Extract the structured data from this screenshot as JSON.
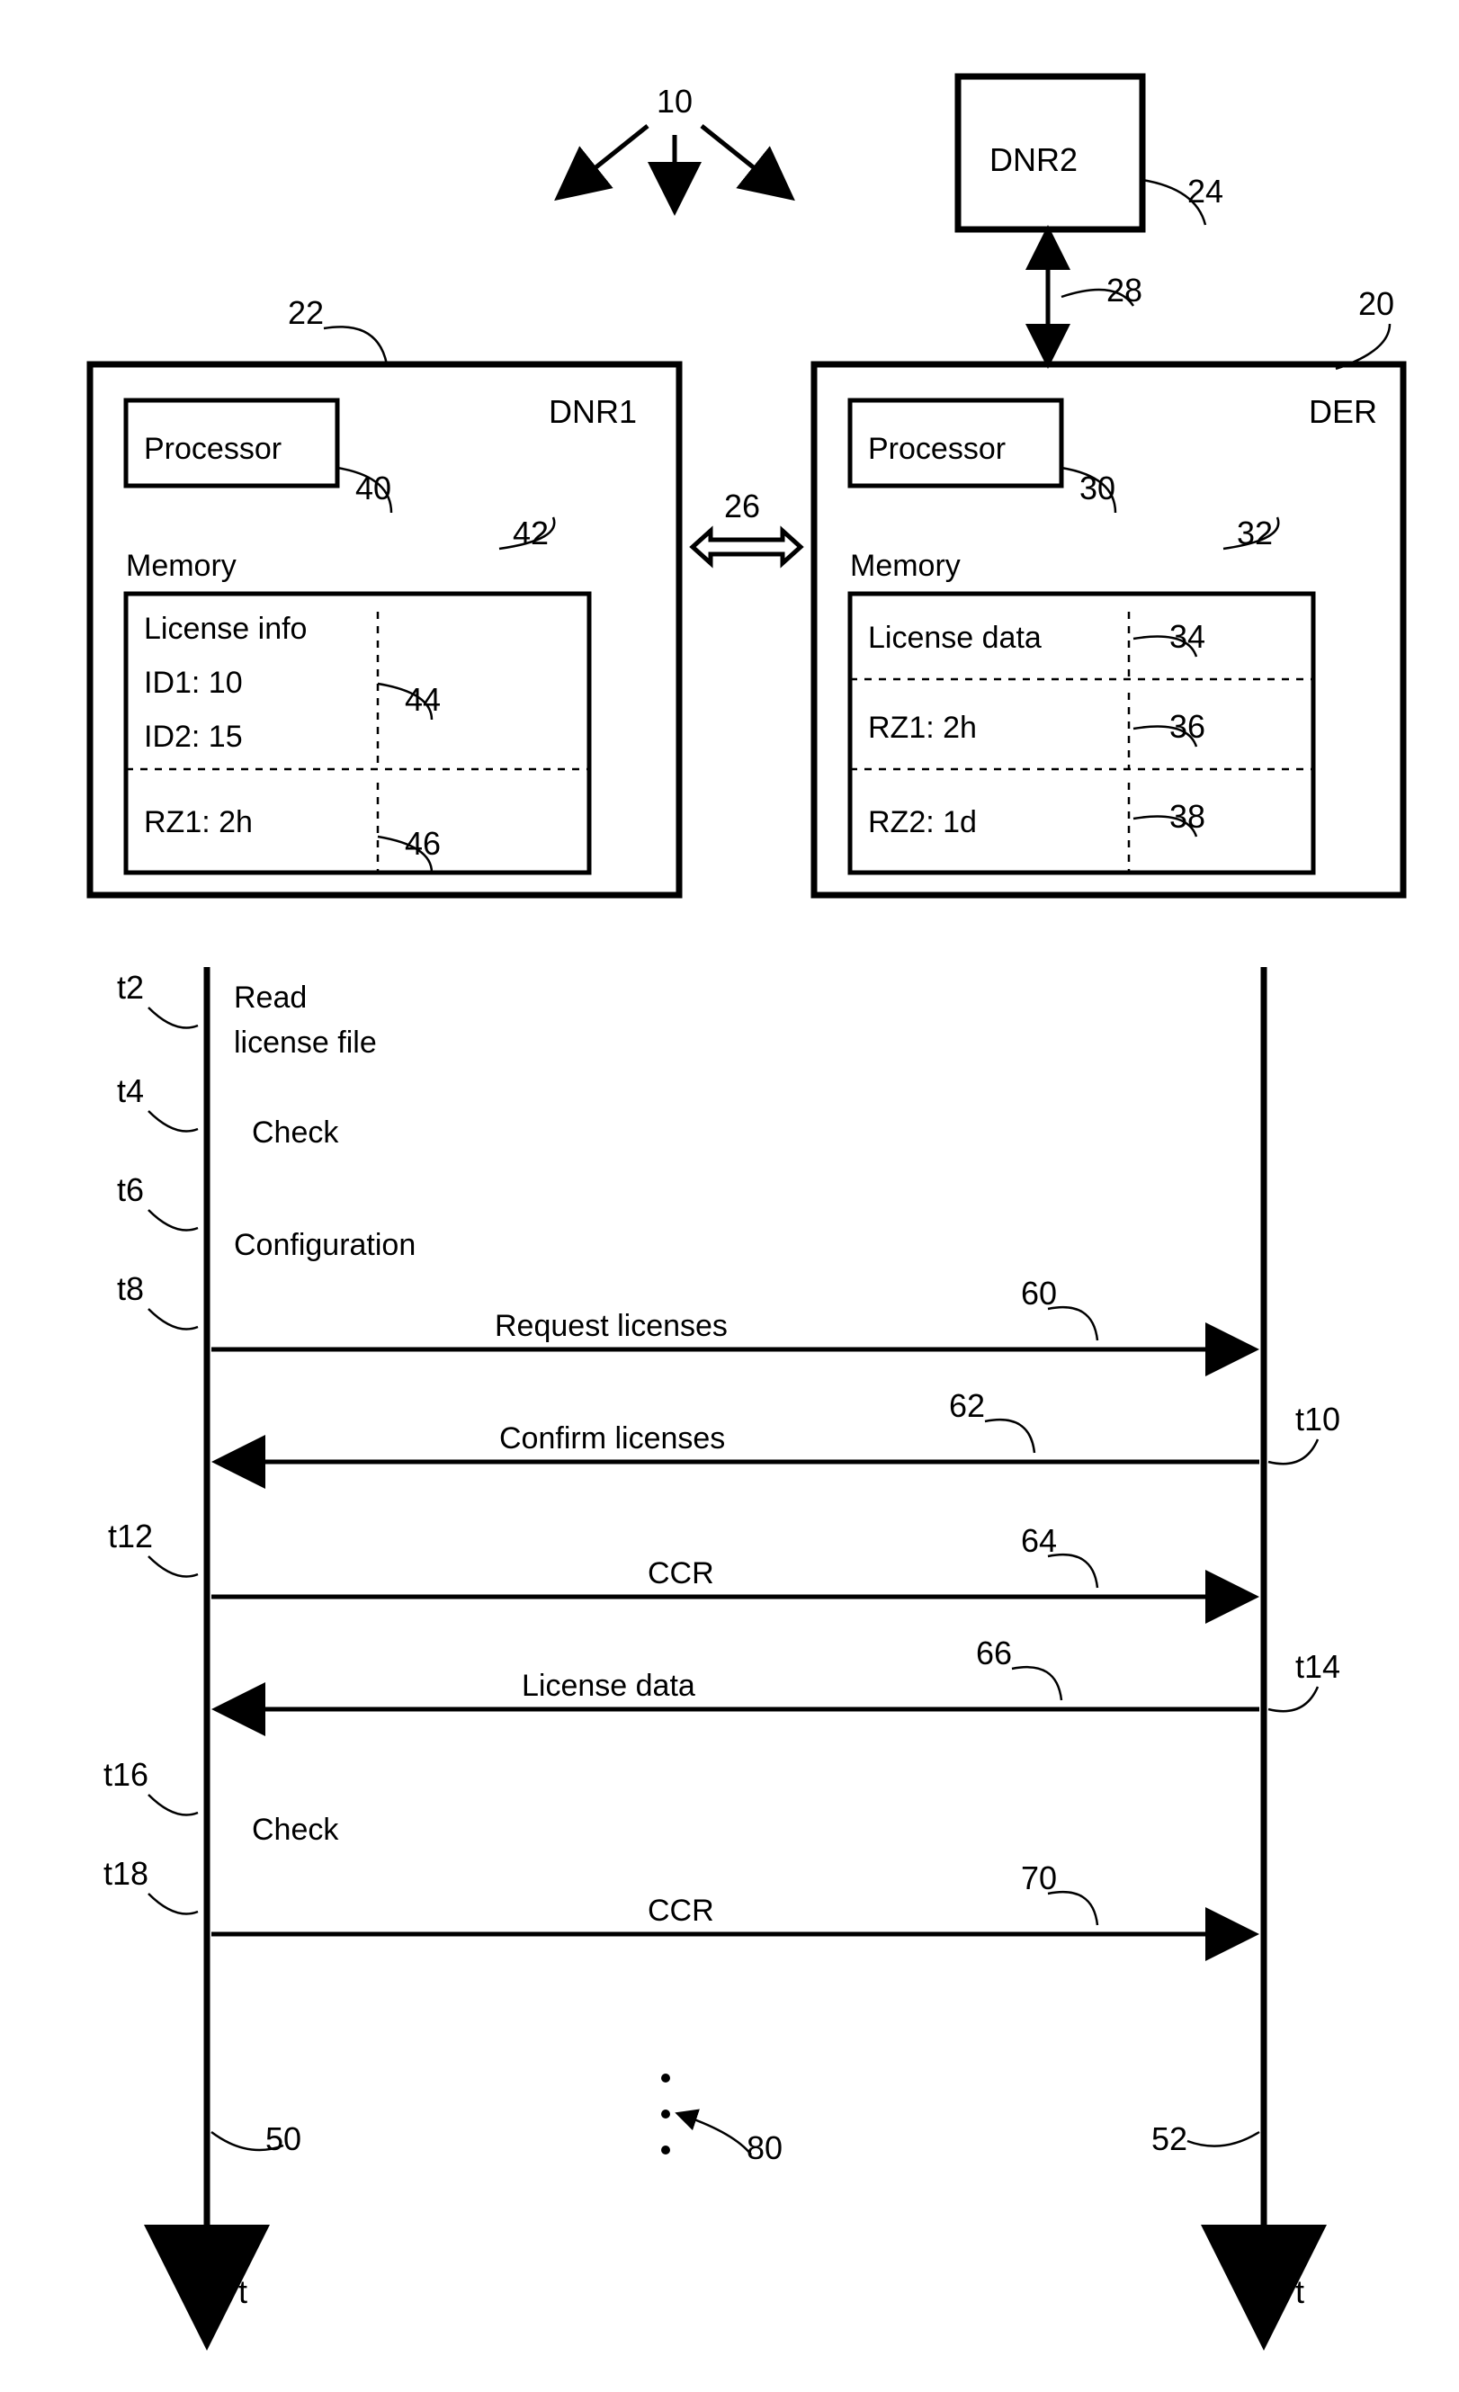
{
  "top": {
    "ref10": "10",
    "dnr2": "DNR2",
    "ref24": "24",
    "ref28": "28",
    "dnr1": "DNR1",
    "ref22": "22",
    "ref26": "26",
    "der": "DER",
    "ref20": "20",
    "proc1": "Processor",
    "ref40": "40",
    "proc2": "Processor",
    "ref30": "30",
    "mem1": "Memory",
    "ref42": "42",
    "mem2": "Memory",
    "ref32": "32",
    "licinfo": "License info",
    "id1": "ID1: 10",
    "id2": "ID2: 15",
    "ref44": "44",
    "rz1a": "RZ1: 2h",
    "ref46": "46",
    "licdata": "License data",
    "ref34": "34",
    "rz1b": "RZ1: 2h",
    "ref36": "36",
    "rz2": "RZ2: 1d",
    "ref38": "38"
  },
  "seq": {
    "t2": "t2",
    "read1": "Read",
    "read2": "license file",
    "t4": "t4",
    "check1": "Check",
    "t6": "t6",
    "config": "Configuration",
    "t8": "t8",
    "msg_req": "Request licenses",
    "ref60": "60",
    "t10": "t10",
    "msg_conf": "Confirm licenses",
    "ref62": "62",
    "t12": "t12",
    "msg_ccr1": "CCR",
    "ref64": "64",
    "t14": "t14",
    "msg_lic": "License data",
    "ref66": "66",
    "t16": "t16",
    "check2": "Check",
    "t18": "t18",
    "msg_ccr2": "CCR",
    "ref70": "70",
    "ref50": "50",
    "ref52": "52",
    "ref80": "80",
    "axis_t": "t"
  }
}
